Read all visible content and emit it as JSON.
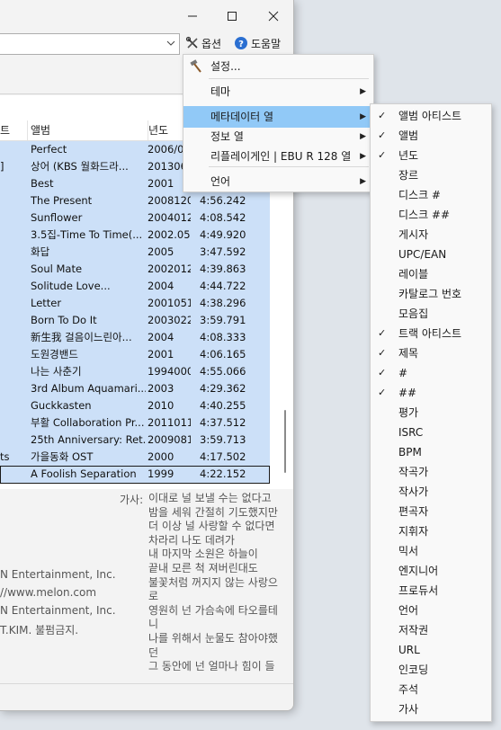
{
  "toolbar": {
    "options_label": "옵션",
    "help_label": "도움말"
  },
  "columns": {
    "artist_partial": "트",
    "album": "앨범",
    "year": "년도"
  },
  "rows": [
    {
      "artist": "",
      "album": "Perfect",
      "year": "2006/04",
      "length": ""
    },
    {
      "artist": "]",
      "album": "상어 (KBS 월화드라...",
      "year": "2013060",
      "length": ""
    },
    {
      "artist": "",
      "album": "Best",
      "year": "2001",
      "length": ""
    },
    {
      "artist": "",
      "album": "The Present",
      "year": "20081209",
      "length": "4:56.242"
    },
    {
      "artist": "",
      "album": "Sunflower",
      "year": "20040127",
      "length": "4:08.542"
    },
    {
      "artist": "",
      "album": "3.5집-Time To Time(...",
      "year": "2002.05",
      "length": "4:49.920"
    },
    {
      "artist": "",
      "album": "화답",
      "year": "2005",
      "length": "3:47.592"
    },
    {
      "artist": "",
      "album": "Soul Mate",
      "year": "20020121",
      "length": "4:39.863"
    },
    {
      "artist": "",
      "album": "Solitude Love...",
      "year": "2004",
      "length": "4:44.722"
    },
    {
      "artist": "",
      "album": "Letter",
      "year": "20010518",
      "length": "4:38.296"
    },
    {
      "artist": "",
      "album": "Born To Do It",
      "year": "20030227",
      "length": "3:59.791"
    },
    {
      "artist": "",
      "album": "新生我 걸음이느린아...",
      "year": "2004",
      "length": "4:08.333"
    },
    {
      "artist": "",
      "album": "도원경밴드",
      "year": "2001",
      "length": "4:06.165"
    },
    {
      "artist": "",
      "album": "나는 사춘기",
      "year": "19940000",
      "length": "4:55.066"
    },
    {
      "artist": "",
      "album": "3rd Album Aquamari...",
      "year": "2003",
      "length": "4:29.362"
    },
    {
      "artist": "",
      "album": "Guckkasten",
      "year": "2010",
      "length": "4:40.255"
    },
    {
      "artist": "",
      "album": "부활 Collaboration Pr...",
      "year": "20110117",
      "length": "4:37.512"
    },
    {
      "artist": "",
      "album": "25th Anniversary: Ret...",
      "year": "20090814",
      "length": "3:59.713"
    },
    {
      "artist": "ts",
      "album": "가을동화 OST",
      "year": "2000",
      "length": "4:17.502"
    },
    {
      "artist": "",
      "album": "A Foolish Separation",
      "year": "1999",
      "length": "4:22.152"
    }
  ],
  "info_lines": [
    "N Entertainment, Inc.",
    "//www.melon.com",
    "N Entertainment, Inc.",
    "T.KIM. 불펌금지."
  ],
  "lyrics_label": "가사:",
  "lyrics_lines": [
    "이대로 널 보낼 수는 없다고",
    "밤을 세워 간절히 기도했지만",
    "더 이상 널 사랑할 수 없다면",
    "차라리 나도 데려가",
    "내 마지막 소원은 하늘이",
    "끝내 모른 척 져버린대도",
    "불꽃처럼 꺼지지 않는 사랑으로",
    "영원히 넌 가슴속에 타오를테니",
    "나를 위해서 눈물도 참아야했던",
    "그 동안에 넌 얼마나 힘이 들"
  ],
  "menu": [
    {
      "label": "설정...",
      "icon": "hammer-icon",
      "submenu": false
    },
    {
      "label": "테마",
      "submenu": true
    },
    {
      "label": "메타데이터 열",
      "submenu": true,
      "highlighted": true
    },
    {
      "label": "정보 열",
      "submenu": true
    },
    {
      "label": "리플레이게인 | EBU R 128 열",
      "submenu": true
    },
    {
      "label": "언어",
      "submenu": true
    }
  ],
  "submenu": [
    {
      "label": "앨범 아티스트",
      "checked": true
    },
    {
      "label": "앨범",
      "checked": true
    },
    {
      "label": "년도",
      "checked": true
    },
    {
      "label": "장르",
      "checked": false
    },
    {
      "label": "디스크 #",
      "checked": false
    },
    {
      "label": "디스크 ##",
      "checked": false
    },
    {
      "label": "게시자",
      "checked": false
    },
    {
      "label": "UPC/EAN",
      "checked": false
    },
    {
      "label": "레이블",
      "checked": false
    },
    {
      "label": "카탈로그 번호",
      "checked": false
    },
    {
      "label": "모음집",
      "checked": false
    },
    {
      "label": "트랙 아티스트",
      "checked": true
    },
    {
      "label": "제목",
      "checked": true
    },
    {
      "label": "#",
      "checked": true
    },
    {
      "label": "##",
      "checked": true
    },
    {
      "label": "평가",
      "checked": false
    },
    {
      "label": "ISRC",
      "checked": false
    },
    {
      "label": "BPM",
      "checked": false
    },
    {
      "label": "작곡가",
      "checked": false
    },
    {
      "label": "작사가",
      "checked": false
    },
    {
      "label": "편곡자",
      "checked": false
    },
    {
      "label": "지휘자",
      "checked": false
    },
    {
      "label": "믹서",
      "checked": false
    },
    {
      "label": "엔지니어",
      "checked": false
    },
    {
      "label": "프로듀서",
      "checked": false
    },
    {
      "label": "언어",
      "checked": false
    },
    {
      "label": "저작권",
      "checked": false
    },
    {
      "label": "URL",
      "checked": false
    },
    {
      "label": "인코딩",
      "checked": false
    },
    {
      "label": "주석",
      "checked": false
    },
    {
      "label": "가사",
      "checked": false
    }
  ],
  "colors": {
    "selection": "#cce0f8",
    "menu_highlight": "#91c9f7",
    "help_icon": "#2b6fd1"
  }
}
